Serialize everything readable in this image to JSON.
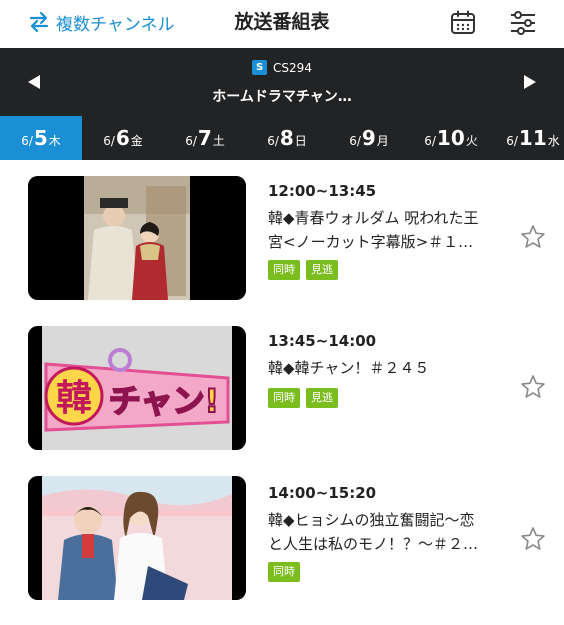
{
  "header": {
    "multi_channel_label": "複数チャンネル",
    "title": "放送番組表"
  },
  "channel": {
    "badge": "S",
    "code": "CS294",
    "name": "ホームドラマチャン…"
  },
  "dates": [
    {
      "month": "6/",
      "day": "5",
      "weekday": "木",
      "active": true
    },
    {
      "month": "6/",
      "day": "6",
      "weekday": "金",
      "active": false
    },
    {
      "month": "6/",
      "day": "7",
      "weekday": "土",
      "active": false
    },
    {
      "month": "6/",
      "day": "8",
      "weekday": "日",
      "active": false
    },
    {
      "month": "6/",
      "day": "9",
      "weekday": "月",
      "active": false
    },
    {
      "month": "6/",
      "day": "10",
      "weekday": "火",
      "active": false
    },
    {
      "month": "6/",
      "day": "11",
      "weekday": "水",
      "active": false
    }
  ],
  "programs": [
    {
      "time": "12:00~13:45",
      "title_line1": "韓◆青春ウォルダム 呪われた王",
      "title_line2": "宮<ノーカット字幕版>＃１…",
      "tags": [
        "同時",
        "見逃"
      ]
    },
    {
      "time": "13:45~14:00",
      "title_line1": "韓◆韓チャン！＃２４５",
      "title_line2": "",
      "tags": [
        "同時",
        "見逃"
      ],
      "thumb_text_1": "韓",
      "thumb_text_2": "チャン!"
    },
    {
      "time": "14:00~15:20",
      "title_line1": "韓◆ヒョシムの独立奮闘記～恋",
      "title_line2": "と人生は私のモノ！？～＃２…",
      "tags": [
        "同時"
      ]
    }
  ],
  "icons": {
    "swap": "swap-arrows-icon",
    "calendar": "calendar-icon",
    "filter": "sliders-icon",
    "prev": "triangle-left-icon",
    "next": "triangle-right-icon",
    "favorite": "star-outline-icon"
  },
  "colors": {
    "accent": "#1a8fd6",
    "bar": "#222325",
    "tag": "#7bbd1f"
  }
}
